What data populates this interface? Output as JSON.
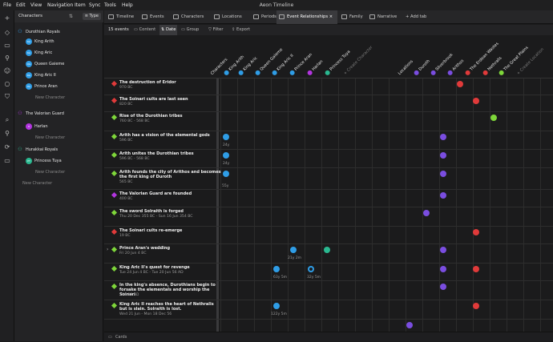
{
  "app_title": "Aeon Timeline",
  "menu": [
    "File",
    "Edit",
    "View",
    "Navigation",
    "Item",
    "Sync",
    "Tools",
    "Help"
  ],
  "left_panel": {
    "title": "Characters",
    "type_button": "Type",
    "groups": [
      {
        "name": "Durothian Royals",
        "color": "#2f9de6",
        "members": [
          {
            "name": "King Arith",
            "initials": "KA",
            "color": "#2f9de6"
          },
          {
            "name": "King Aric",
            "initials": "KA",
            "color": "#2f9de6"
          },
          {
            "name": "Queen Gaieme",
            "initials": "QG",
            "color": "#2f9de6"
          },
          {
            "name": "King Aric II",
            "initials": "KA",
            "color": "#2f9de6"
          },
          {
            "name": "Prince Aran",
            "initials": "PA",
            "color": "#2f9de6"
          }
        ],
        "new_label": "New Character"
      },
      {
        "name": "The Valorian Guard",
        "color": "#b335e0",
        "members": [
          {
            "name": "Harlan",
            "initials": "H",
            "color": "#b335e0"
          }
        ],
        "new_label": "New Character"
      },
      {
        "name": "Hurakkai Royals",
        "color": "#2ab890",
        "members": [
          {
            "name": "Princess Tuya",
            "initials": "PT",
            "color": "#2ab890"
          }
        ],
        "new_label": "New Character"
      }
    ],
    "root_new_label": "New Character"
  },
  "tabs": [
    "Timeline",
    "Events",
    "Characters",
    "Locations",
    "Periods",
    "Event Relationships",
    "Family",
    "Narrative",
    "+ Add tab"
  ],
  "active_tab": "Event Relationships",
  "toolbar": {
    "count": "15 events",
    "items": [
      "Content",
      "Date",
      "Group",
      "Filter",
      "Export"
    ],
    "selected": "Date"
  },
  "columns": {
    "characters_header": "Characters",
    "characters": [
      {
        "name": "King Arith",
        "color": "#2f9de6"
      },
      {
        "name": "King Aric",
        "color": "#2f9de6"
      },
      {
        "name": "Queen Gaieme",
        "color": "#2f9de6"
      },
      {
        "name": "King Aric II",
        "color": "#2f9de6"
      },
      {
        "name": "Prince Aran",
        "color": "#2f9de6"
      },
      {
        "name": "Harlan",
        "color": "#b335e0"
      },
      {
        "name": "Princess Tuya",
        "color": "#2ab890"
      }
    ],
    "create_character": "+ Create Character",
    "locations_header": "Locations",
    "locations": [
      {
        "name": "Duroth",
        "color": "#7a4de0"
      },
      {
        "name": "Silverbrook",
        "color": "#7a4de0"
      },
      {
        "name": "Arithos",
        "color": "#7a4de0"
      },
      {
        "name": "The Erdean Wastes",
        "color": "#e03a3a"
      },
      {
        "name": "Nethralis",
        "color": "#e03a3a"
      },
      {
        "name": "The Great Plains",
        "color": "#7ed63a"
      }
    ],
    "create_location": "+ Create Location"
  },
  "events": [
    {
      "title": "The destruction of Eridor",
      "date": "970 BC",
      "color": "#e03a3a"
    },
    {
      "title": "The Soinari cults are last seen",
      "date": "820 BC",
      "color": "#e03a3a"
    },
    {
      "title": "Rise of the Durothian tribes",
      "date": "760 BC - 568 BC",
      "color": "#7ed63a"
    },
    {
      "title": "Arith has a vision of the elemental gods",
      "date": "596 BC",
      "color": "#7ed63a"
    },
    {
      "title": "Arith unites the Durothian tribes",
      "date": "596 BC - 568 BC",
      "color": "#7ed63a"
    },
    {
      "title": "Arith founds the city of Arithos and becomes the first king of Duroth",
      "date": "565 BC",
      "color": "#7ed63a"
    },
    {
      "title": "The Valorian Guard are founded",
      "date": "400 BC",
      "color": "#b335e0"
    },
    {
      "title": "The sword Solraith is forged",
      "date": "Thu 20 Dec 355 BC - Sun 16 Jun 354 BC",
      "color": "#7ed63a"
    },
    {
      "title": "The Soinari cults re-emerge",
      "date": "19 BC",
      "color": "#e03a3a"
    },
    {
      "title": "Prince Aran's wedding",
      "date": "Fri 20 Jun 4 BC",
      "color": "#7ed63a"
    },
    {
      "title": "King Aric II's quest for revenge",
      "date": "Tue 24 Jun 4 BC - Tue 20 Jun 56 AD",
      "color": "#7ed63a"
    },
    {
      "title": "In the king's absence, Durothians begin to forsake the elementals and worship the Soinari",
      "date": "28 - 99 AD",
      "color": "#7ed63a"
    },
    {
      "title": "King Aric II reaches the heart of Nethralis but is slain. Solraith is lost.",
      "date": "Wed 21 Jun - Mon 18 Dec 56",
      "color": "#7ed63a"
    }
  ],
  "dot_labels": [
    "24y",
    "24y",
    "55y",
    "21y 2m",
    "63y 5m",
    "32y 5m",
    "122y 5m"
  ],
  "status": "Cards"
}
